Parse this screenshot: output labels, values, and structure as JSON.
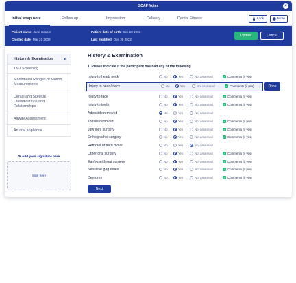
{
  "window": {
    "title": "SOAP Notes"
  },
  "tabs": [
    "Initial soap note",
    "Follow up",
    "Impression",
    "Delivery",
    "Dental Fitness"
  ],
  "top_buttons": {
    "lock": "Lock",
    "more": "More"
  },
  "patient": {
    "name_label": "Patient name",
    "name_value": "Jane Cooper",
    "created_label": "Created date",
    "created_value": "Mar 21 2002",
    "dob_label": "Patient date of birth",
    "dob_value": "Dec 23 1991",
    "modified_label": "Last modified",
    "modified_value": "Dec 26 2022"
  },
  "actions": {
    "update": "Update",
    "cancel": "Cancel",
    "done": "Done",
    "next": "Next"
  },
  "sidebar": {
    "items": [
      {
        "label": "History & Examination"
      },
      {
        "label": "TMJ Screening"
      },
      {
        "label": "Mandibular Ranges of Motion Measurements"
      },
      {
        "label": "Dental and Skeletal Classifications and Relationships"
      },
      {
        "label": "Airway Assessment"
      },
      {
        "label": "An oral appliance"
      }
    ],
    "signature_label": "Add your signature here",
    "sign_here": "Sign here"
  },
  "main": {
    "title": "History & Examination",
    "question": "1. Please indicate if the participant has had any of the following",
    "options": {
      "no": "No",
      "yes": "Yes",
      "na": "Not assessed",
      "comments": "Comments (if yes)"
    },
    "rows": [
      {
        "label": "Injury to head/ neck",
        "selected": "yes",
        "comments": true
      },
      {
        "label": "Injury to head/ neck",
        "selected": "yes",
        "comments": true,
        "highlight": true
      },
      {
        "label": "Injury to face",
        "selected": "yes",
        "comments": true
      },
      {
        "label": "Injury to teeth",
        "selected": "yes",
        "comments": true
      },
      {
        "label": "Adenoids removed",
        "selected": "no",
        "comments": false
      },
      {
        "label": "Tonsils removed",
        "selected": "yes",
        "comments": true
      },
      {
        "label": "Jaw joint surgery",
        "selected": "yes",
        "comments": true
      },
      {
        "label": "Orthognathic surgery",
        "selected": "yes",
        "comments": true
      },
      {
        "label": "Remove of third molar",
        "selected": "na",
        "comments": false
      },
      {
        "label": "Other oral surgery",
        "selected": "yes",
        "comments": true
      },
      {
        "label": "Ear/nose/throat surgery",
        "selected": "yes",
        "comments": true
      },
      {
        "label": "Sensitive gag reflex",
        "selected": "yes",
        "comments": true
      },
      {
        "label": "Dentures",
        "selected": "yes",
        "comments": true
      }
    ]
  },
  "colors": {
    "primary": "#1f3b9e",
    "success": "#29b67a"
  }
}
